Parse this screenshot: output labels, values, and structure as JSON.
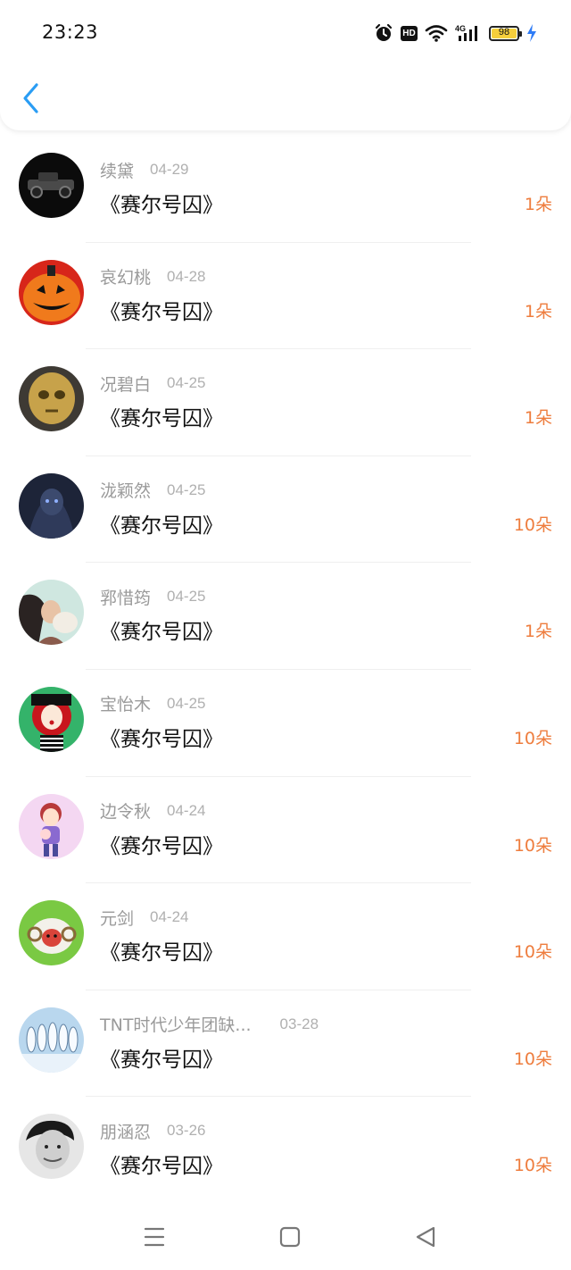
{
  "status_bar": {
    "time": "23:23",
    "hd_label": "HD",
    "network_label": "4G",
    "battery": "98",
    "icons": [
      "alarm-icon",
      "hd-icon",
      "wifi-icon",
      "cellular-signal-icon",
      "battery-icon",
      "charging-icon"
    ]
  },
  "header": {
    "back_icon": "chevron-left-icon",
    "accent_color": "#2a9df4"
  },
  "colors": {
    "amount": "#ee7d3e",
    "name": "#9a9a9a",
    "date": "#b0b0b0",
    "book": "#111111"
  },
  "records": [
    {
      "name": "续黛",
      "date": "04-29",
      "book": "《赛尔号囚》",
      "amount": "1朵"
    },
    {
      "name": "哀幻桃",
      "date": "04-28",
      "book": "《赛尔号囚》",
      "amount": "1朵"
    },
    {
      "name": "况碧白",
      "date": "04-25",
      "book": "《赛尔号囚》",
      "amount": "1朵"
    },
    {
      "name": "泷颖然",
      "date": "04-25",
      "book": "《赛尔号囚》",
      "amount": "10朵"
    },
    {
      "name": "郛惜筠",
      "date": "04-25",
      "book": "《赛尔号囚》",
      "amount": "1朵"
    },
    {
      "name": "宝怡木",
      "date": "04-25",
      "book": "《赛尔号囚》",
      "amount": "10朵"
    },
    {
      "name": "边令秋",
      "date": "04-24",
      "book": "《赛尔号囚》",
      "amount": "10朵"
    },
    {
      "name": "元剑",
      "date": "04-24",
      "book": "《赛尔号囚》",
      "amount": "10朵"
    },
    {
      "name": "TNT时代少年团缺...",
      "date": "03-28",
      "book": "《赛尔号囚》",
      "amount": "10朵"
    },
    {
      "name": "朋涵忍",
      "date": "03-26",
      "book": "《赛尔号囚》",
      "amount": "10朵"
    }
  ],
  "nav_bar": {
    "icons": [
      "menu-icon",
      "home-square-icon",
      "back-triangle-icon"
    ]
  }
}
